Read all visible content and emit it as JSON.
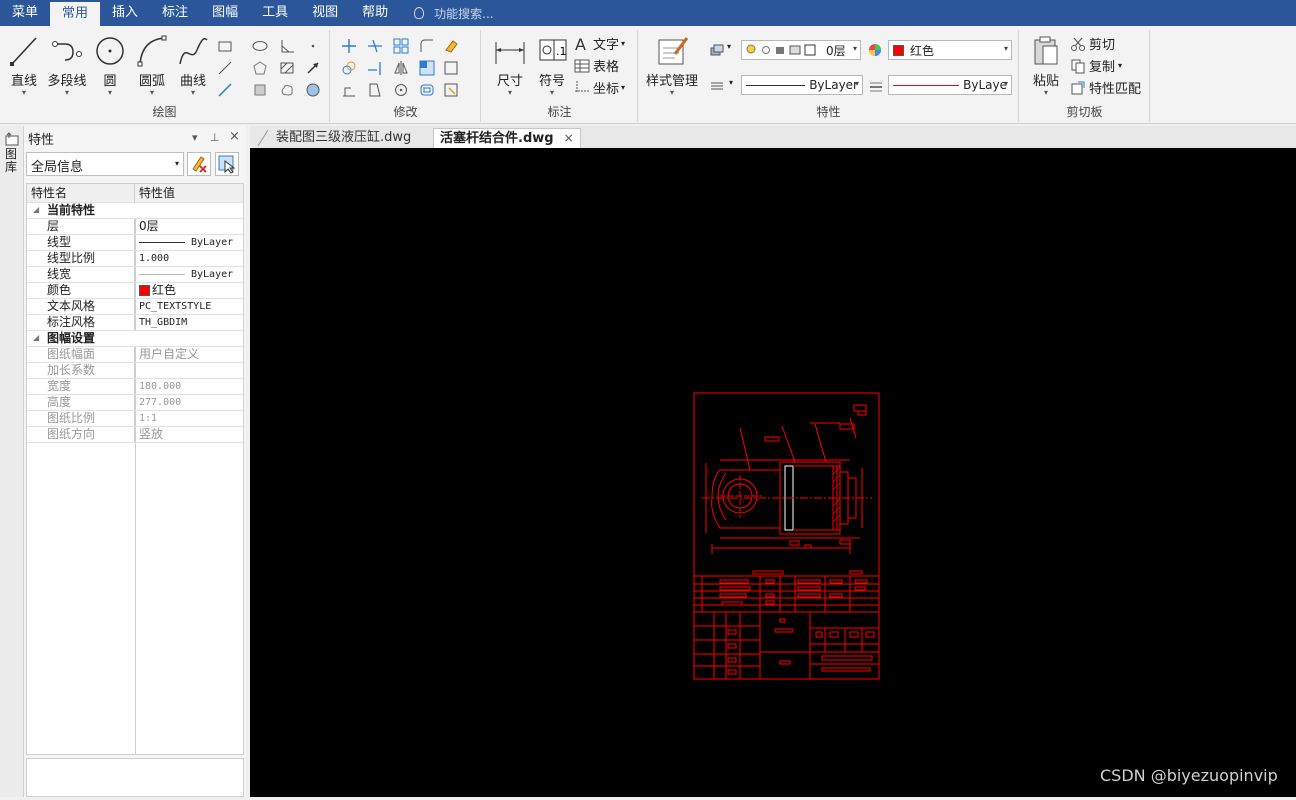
{
  "menu": {
    "items": [
      "菜单",
      "常用",
      "插入",
      "标注",
      "图幅",
      "工具",
      "视图",
      "帮助"
    ],
    "active": "常用",
    "search_placeholder": "功能搜索..."
  },
  "ribbon": {
    "draw": {
      "label": "绘图",
      "line": "直线",
      "polyline": "多段线",
      "circle": "圆",
      "arc": "圆弧",
      "curve": "曲线"
    },
    "modify": {
      "label": "修改"
    },
    "annotate": {
      "label": "标注",
      "dimension": "尺寸",
      "symbol": "符号",
      "text": "文字",
      "table": "表格",
      "coordinate": "坐标"
    },
    "properties": {
      "label": "特性",
      "style_manager": "样式管理",
      "layer_value": "0层",
      "color_value": "红色",
      "linetype_value": "ByLayer",
      "lineweight_value": "ByLaye"
    },
    "clipboard": {
      "label": "剪切板",
      "paste": "粘贴",
      "cut": "剪切",
      "copy": "复制",
      "match": "特性匹配"
    }
  },
  "side_strip": {
    "label": "图库"
  },
  "panel": {
    "title": "特性",
    "scope_select": "全局信息",
    "header": {
      "name": "特性名",
      "value": "特性值"
    },
    "categories": [
      {
        "title": "当前特性",
        "rows": [
          {
            "name": "层",
            "value": "0层"
          },
          {
            "name": "线型",
            "value": "ByLayer"
          },
          {
            "name": "线型比例",
            "value": "1.000"
          },
          {
            "name": "线宽",
            "value": "ByLayer"
          },
          {
            "name": "颜色",
            "value": "红色"
          },
          {
            "name": "文本风格",
            "value": "PC_TEXTSTYLE"
          },
          {
            "name": "标注风格",
            "value": "TH_GBDIM"
          }
        ]
      },
      {
        "title": "图幅设置",
        "rows": [
          {
            "name": "图纸幅面",
            "value": "用户自定义"
          },
          {
            "name": "加长系数",
            "value": ""
          },
          {
            "name": "宽度",
            "value": "180.000"
          },
          {
            "name": "高度",
            "value": "277.000"
          },
          {
            "name": "图纸比例",
            "value": "1:1"
          },
          {
            "name": "图纸方向",
            "value": "竖放"
          }
        ]
      }
    ]
  },
  "tabs": [
    {
      "label": "装配图三级液压缸.dwg",
      "active": false
    },
    {
      "label": "活塞杆结合件.dwg",
      "active": true
    }
  ],
  "canvas": {
    "background": "#000000",
    "drawing_color": "#ff0000"
  },
  "watermark": "CSDN @biyezuopinvip"
}
